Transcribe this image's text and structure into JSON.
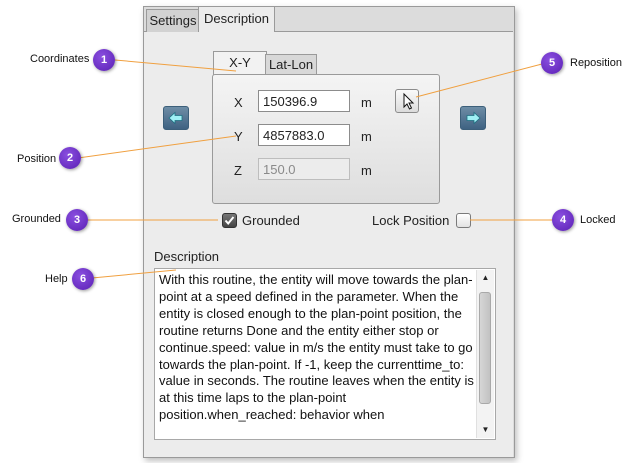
{
  "outer_tabs": {
    "settings": "Settings",
    "description": "Description"
  },
  "inner_tabs": {
    "xy": "X-Y",
    "latlon": "Lat-Lon"
  },
  "fields": {
    "x": {
      "label": "X",
      "value": "150396.9",
      "unit": "m"
    },
    "y": {
      "label": "Y",
      "value": "4857883.0",
      "unit": "m"
    },
    "z": {
      "label": "Z",
      "value": "150.0",
      "unit": "m"
    }
  },
  "grounded": {
    "label": "Grounded",
    "checked": true
  },
  "lock_position": {
    "label": "Lock Position",
    "checked": false
  },
  "description": {
    "heading": "Description",
    "text": "With this routine, the entity will move towards the plan-point at a speed defined in the parameter. When the entity is closed enough to the plan-point position, the routine returns Done and the entity either stop or continue.speed: value in m/s the entity must take to go towards the plan-point. If -1, keep the currenttime_to: value in seconds. The routine leaves when the entity is at this time laps to the plan-point position.when_reached: behavior when"
  },
  "callouts": [
    {
      "num": "1",
      "label": "Coordinates"
    },
    {
      "num": "2",
      "label": "Position"
    },
    {
      "num": "3",
      "label": "Grounded"
    },
    {
      "num": "4",
      "label": "Locked"
    },
    {
      "num": "5",
      "label": "Reposition"
    },
    {
      "num": "6",
      "label": "Help"
    }
  ],
  "icons": {
    "left_arrow": "left-arrow-icon",
    "right_arrow": "right-arrow-icon",
    "cursor": "cursor-icon",
    "checkmark": "checkmark-icon"
  },
  "colors": {
    "callout": "#6a2fcc",
    "callout_line": "#f0a040",
    "arrow_button": "#4a6d8c"
  }
}
